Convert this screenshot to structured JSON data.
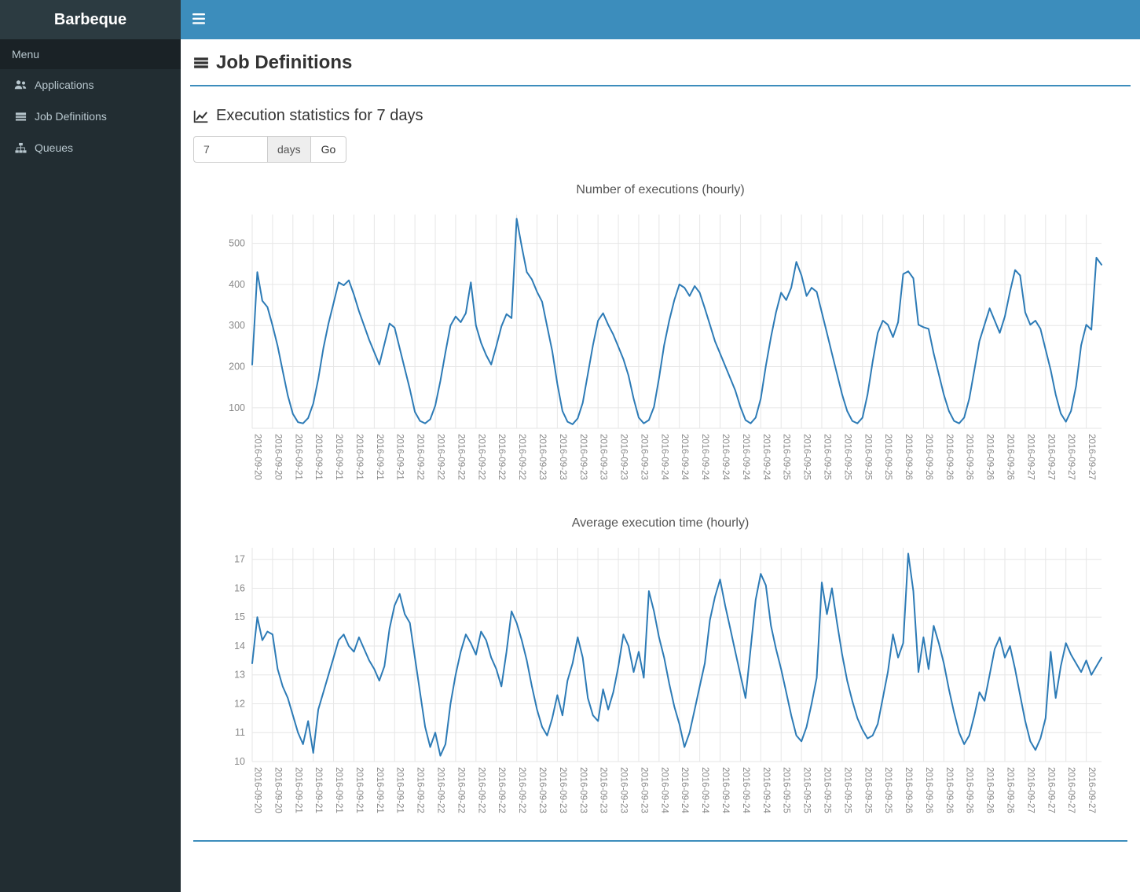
{
  "brand": "Barbeque",
  "navbar": {
    "toggle_icon": "bars-icon"
  },
  "sidebar": {
    "menu_header": "Menu",
    "items": [
      {
        "label": "Applications",
        "icon": "users-icon"
      },
      {
        "label": "Job Definitions",
        "icon": "table-icon"
      },
      {
        "label": "Queues",
        "icon": "sitemap-icon"
      }
    ]
  },
  "page": {
    "title": "Job Definitions",
    "title_icon": "list-icon"
  },
  "stats_panel": {
    "title": "Execution statistics for 7 days",
    "title_icon": "line-chart-icon",
    "days_input": {
      "value": "7",
      "addon": "days"
    },
    "go_button": "Go"
  },
  "colors": {
    "navbar": "#3c8dbc",
    "logo_bg": "#2c3b41",
    "sidebar_bg": "#222d32",
    "accent_line": "#3c8dbc",
    "chart_line": "#2d7bb6"
  },
  "chart_data": [
    {
      "type": "line",
      "title": "Number of executions (hourly)",
      "xlabel": "",
      "ylabel": "",
      "ylim": [
        50,
        570
      ],
      "yticks": [
        100,
        200,
        300,
        400,
        500
      ],
      "grid": true,
      "legend": "none",
      "color": "#2d7bb6",
      "x_labels": [
        "2016-09-20",
        "2016-09-20",
        "2016-09-21",
        "2016-09-21",
        "2016-09-21",
        "2016-09-21",
        "2016-09-21",
        "2016-09-21",
        "2016-09-22",
        "2016-09-22",
        "2016-09-22",
        "2016-09-22",
        "2016-09-22",
        "2016-09-22",
        "2016-09-23",
        "2016-09-23",
        "2016-09-23",
        "2016-09-23",
        "2016-09-23",
        "2016-09-23",
        "2016-09-24",
        "2016-09-24",
        "2016-09-24",
        "2016-09-24",
        "2016-09-24",
        "2016-09-24",
        "2016-09-25",
        "2016-09-25",
        "2016-09-25",
        "2016-09-25",
        "2016-09-25",
        "2016-09-25",
        "2016-09-26",
        "2016-09-26",
        "2016-09-26",
        "2016-09-26",
        "2016-09-26",
        "2016-09-26",
        "2016-09-27",
        "2016-09-27",
        "2016-09-27",
        "2016-09-27"
      ],
      "values": [
        205,
        430,
        360,
        345,
        300,
        250,
        190,
        130,
        85,
        65,
        62,
        75,
        110,
        170,
        245,
        305,
        355,
        405,
        398,
        410,
        375,
        335,
        300,
        265,
        235,
        205,
        255,
        305,
        295,
        245,
        195,
        145,
        90,
        68,
        62,
        72,
        105,
        165,
        235,
        300,
        322,
        308,
        330,
        405,
        300,
        258,
        228,
        205,
        250,
        298,
        328,
        318,
        560,
        492,
        430,
        412,
        382,
        358,
        298,
        238,
        158,
        92,
        66,
        60,
        74,
        112,
        182,
        252,
        312,
        330,
        302,
        278,
        248,
        218,
        178,
        122,
        76,
        62,
        70,
        102,
        172,
        252,
        312,
        362,
        400,
        392,
        372,
        396,
        380,
        342,
        302,
        262,
        232,
        202,
        172,
        142,
        102,
        70,
        62,
        76,
        122,
        202,
        272,
        332,
        380,
        362,
        392,
        455,
        422,
        372,
        392,
        382,
        332,
        282,
        232,
        182,
        132,
        92,
        68,
        62,
        76,
        132,
        212,
        282,
        312,
        302,
        272,
        308,
        425,
        432,
        415,
        302,
        296,
        292,
        232,
        182,
        132,
        92,
        68,
        62,
        76,
        122,
        192,
        262,
        302,
        342,
        312,
        282,
        322,
        382,
        435,
        422,
        332,
        302,
        312,
        292,
        242,
        192,
        132,
        86,
        66,
        92,
        152,
        252,
        302,
        290,
        465,
        448
      ]
    },
    {
      "type": "line",
      "title": "Average execution time (hourly)",
      "xlabel": "",
      "ylabel": "",
      "ylim": [
        10,
        17.4
      ],
      "yticks": [
        10,
        11,
        12,
        13,
        14,
        15,
        16,
        17
      ],
      "grid": true,
      "legend": "none",
      "color": "#2d7bb6",
      "x_labels": [
        "2016-09-20",
        "2016-09-20",
        "2016-09-21",
        "2016-09-21",
        "2016-09-21",
        "2016-09-21",
        "2016-09-21",
        "2016-09-21",
        "2016-09-22",
        "2016-09-22",
        "2016-09-22",
        "2016-09-22",
        "2016-09-22",
        "2016-09-22",
        "2016-09-23",
        "2016-09-23",
        "2016-09-23",
        "2016-09-23",
        "2016-09-23",
        "2016-09-23",
        "2016-09-24",
        "2016-09-24",
        "2016-09-24",
        "2016-09-24",
        "2016-09-24",
        "2016-09-24",
        "2016-09-25",
        "2016-09-25",
        "2016-09-25",
        "2016-09-25",
        "2016-09-25",
        "2016-09-25",
        "2016-09-26",
        "2016-09-26",
        "2016-09-26",
        "2016-09-26",
        "2016-09-26",
        "2016-09-26",
        "2016-09-27",
        "2016-09-27",
        "2016-09-27",
        "2016-09-27"
      ],
      "values": [
        13.4,
        15.0,
        14.2,
        14.5,
        14.4,
        13.2,
        12.6,
        12.2,
        11.6,
        11.0,
        10.6,
        11.4,
        10.3,
        11.8,
        12.4,
        13.0,
        13.6,
        14.2,
        14.4,
        14.0,
        13.8,
        14.3,
        13.9,
        13.5,
        13.2,
        12.8,
        13.3,
        14.6,
        15.4,
        15.8,
        15.1,
        14.8,
        13.6,
        12.4,
        11.2,
        10.5,
        11.0,
        10.2,
        10.6,
        12.0,
        13.0,
        13.8,
        14.4,
        14.1,
        13.7,
        14.5,
        14.2,
        13.6,
        13.2,
        12.6,
        13.8,
        15.2,
        14.8,
        14.2,
        13.5,
        12.6,
        11.8,
        11.2,
        10.9,
        11.5,
        12.3,
        11.6,
        12.8,
        13.4,
        14.3,
        13.6,
        12.2,
        11.6,
        11.4,
        12.5,
        11.8,
        12.4,
        13.3,
        14.4,
        14.0,
        13.1,
        13.8,
        12.9,
        15.9,
        15.2,
        14.3,
        13.6,
        12.7,
        11.9,
        11.3,
        10.5,
        11.0,
        11.8,
        12.6,
        13.4,
        14.9,
        15.7,
        16.3,
        15.4,
        14.6,
        13.8,
        13.0,
        12.2,
        13.9,
        15.6,
        16.5,
        16.1,
        14.7,
        13.9,
        13.2,
        12.4,
        11.6,
        10.9,
        10.7,
        11.2,
        12.0,
        12.9,
        16.2,
        15.1,
        16.0,
        14.8,
        13.7,
        12.8,
        12.1,
        11.5,
        11.1,
        10.8,
        10.9,
        11.3,
        12.2,
        13.1,
        14.4,
        13.6,
        14.1,
        17.2,
        15.9,
        13.1,
        14.3,
        13.2,
        14.7,
        14.1,
        13.4,
        12.5,
        11.7,
        11.0,
        10.6,
        10.9,
        11.6,
        12.4,
        12.1,
        13.0,
        13.9,
        14.3,
        13.6,
        14.0,
        13.2,
        12.3,
        11.4,
        10.7,
        10.4,
        10.8,
        11.5,
        13.8,
        12.2,
        13.3,
        14.1,
        13.7,
        13.4,
        13.1,
        13.5,
        13.0,
        13.3,
        13.6
      ]
    }
  ]
}
